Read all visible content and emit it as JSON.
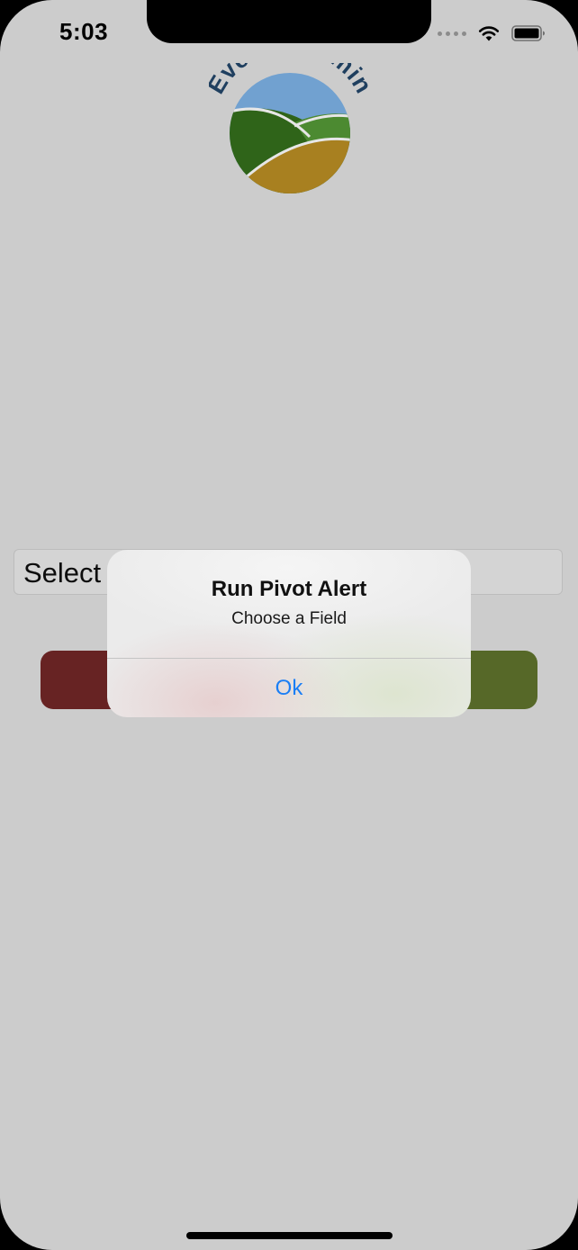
{
  "status_bar": {
    "time": "5:03",
    "signal_icon": "cellular-signal-icon",
    "wifi_icon": "wifi-icon",
    "battery_icon": "battery-icon"
  },
  "logo": {
    "text": "EvenStreamin",
    "colors": {
      "text": "#1f3f5f",
      "sky": "#71a1d0",
      "hill_dark": "#2f6419",
      "hill_light": "#4c8a31",
      "field": "#a88020"
    }
  },
  "select_field": {
    "label": "Select"
  },
  "buttons": {
    "cancel_color": "#672323",
    "run_color": "#566828"
  },
  "alert": {
    "title": "Run Pivot Alert",
    "message": "Choose a Field",
    "ok_label": "Ok",
    "accent": "#1a7ef5"
  }
}
